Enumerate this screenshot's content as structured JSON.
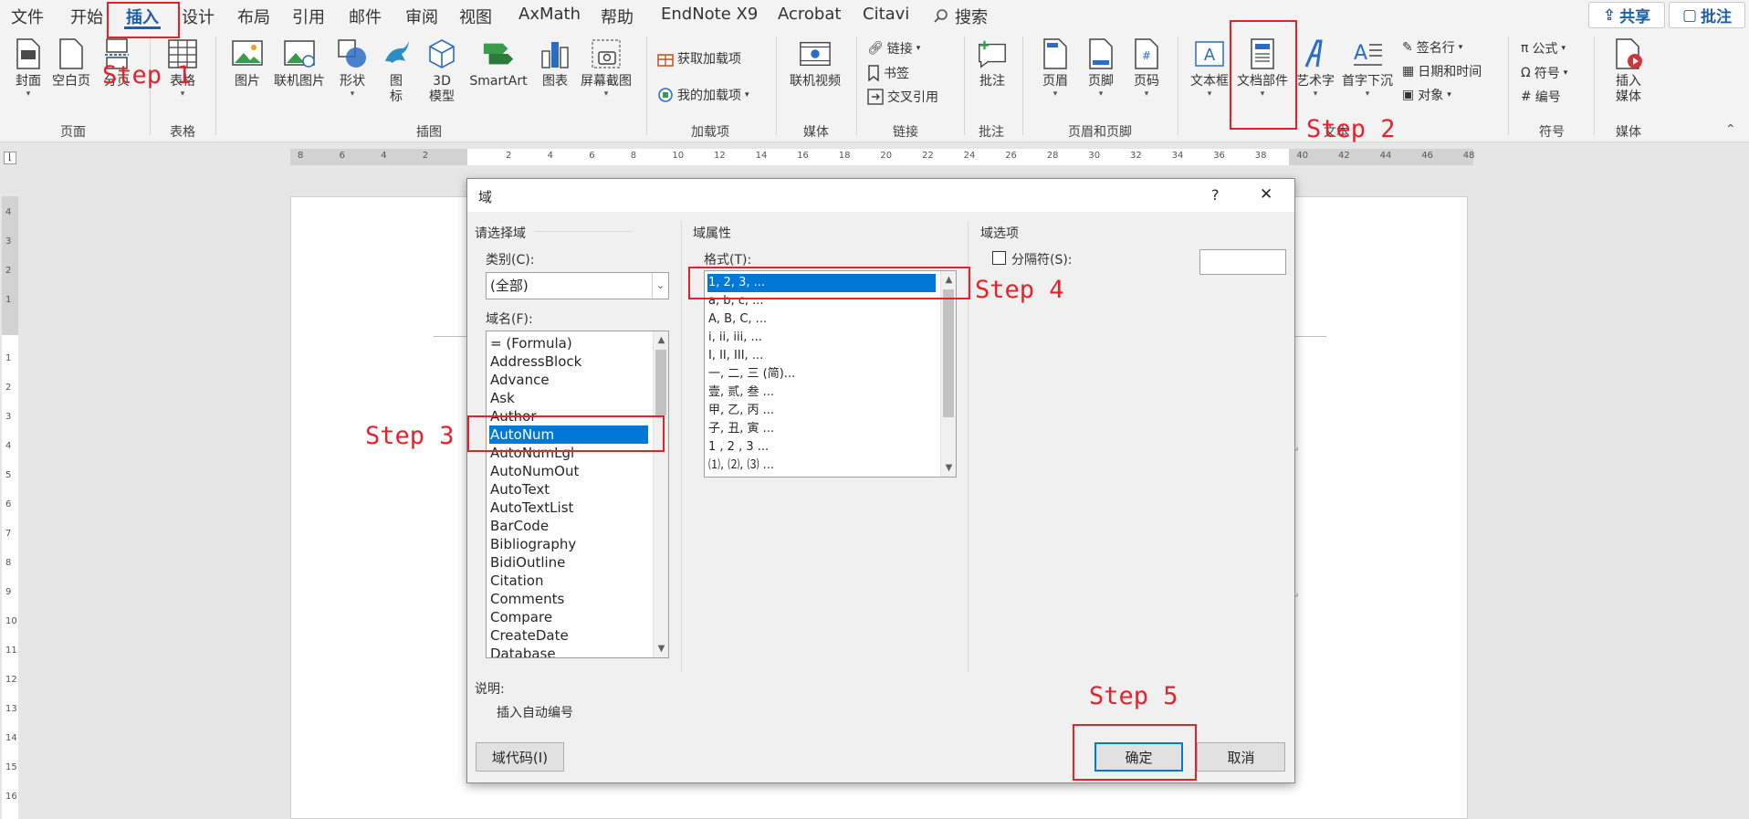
{
  "menu": {
    "tabs": [
      "文件",
      "开始",
      "插入",
      "设计",
      "布局",
      "引用",
      "邮件",
      "审阅",
      "视图",
      "AxMath",
      "帮助",
      "EndNote X9",
      "Acrobat",
      "Citavi"
    ],
    "active_tab": "插入",
    "search_label": "搜索",
    "share_label": "共享",
    "comments_label": "批注"
  },
  "ribbon": {
    "pages_group": {
      "label": "页面",
      "cover": "封面",
      "blank_page": "空白页",
      "page_break": "分页"
    },
    "table_group": {
      "label": "表格",
      "table": "表格"
    },
    "illustrations_group": {
      "label": "插图",
      "picture": "图片",
      "online_picture": "联机图片",
      "shapes": "形状",
      "icons_line1": "图",
      "icons_line2": "标",
      "model_line1": "3D",
      "model_line2": "模型",
      "smartart": "SmartArt",
      "chart": "图表",
      "screenshot": "屏幕截图"
    },
    "addins_group": {
      "label": "加载项",
      "get_addins": "获取加载项",
      "my_addins": "我的加载项"
    },
    "media_group": {
      "label": "媒体",
      "online_video": "联机视频"
    },
    "links_group": {
      "label": "链接",
      "link": "链接",
      "bookmark": "书签",
      "cross_ref": "交叉引用"
    },
    "comments_group": {
      "label": "批注",
      "comment": "批注"
    },
    "header_footer_group": {
      "label": "页眉和页脚",
      "header": "页眉",
      "footer": "页脚",
      "page_number": "页码"
    },
    "text_group": {
      "label": "文本",
      "textbox": "文本框",
      "quick_parts": "文档部件",
      "wordart": "艺术字",
      "dropcap": "首字下沉",
      "signature": "签名行",
      "datetime": "日期和时间",
      "object": "对象"
    },
    "symbols_group": {
      "label": "符号",
      "equation": "公式",
      "symbol": "符号",
      "number": "编号"
    },
    "media2_group": {
      "label": "媒体",
      "insert_media_line1": "插入",
      "insert_media_line2": "媒体"
    }
  },
  "ruler": {
    "ticks": [
      "8",
      "6",
      "4",
      "2",
      "",
      "2",
      "4",
      "6",
      "8",
      "10",
      "12",
      "14",
      "16",
      "18",
      "20",
      "22",
      "24",
      "26",
      "28",
      "30",
      "32",
      "34",
      "36",
      "38",
      "40",
      "42",
      "44",
      "46",
      "48"
    ],
    "vticks": [
      "4",
      "3",
      "2",
      "1",
      "",
      "1",
      "2",
      "3",
      "4",
      "5",
      "6",
      "7",
      "8",
      "9",
      "10",
      "11",
      "12",
      "13",
      "14",
      "15",
      "16"
    ]
  },
  "dialog": {
    "title": "域",
    "help": "?",
    "close": "✕",
    "choose_field_title": "请选择域",
    "category_label": "类别(C):",
    "category_value": "(全部)",
    "field_names_label": "域名(F):",
    "field_names": [
      "= (Formula)",
      "AddressBlock",
      "Advance",
      "Ask",
      "Author",
      "AutoNum",
      "AutoNumLgl",
      "AutoNumOut",
      "AutoText",
      "AutoTextList",
      "BarCode",
      "Bibliography",
      "BidiOutline",
      "Citation",
      "Comments",
      "Compare",
      "CreateDate",
      "Database"
    ],
    "selected_field": "AutoNum",
    "field_properties_title": "域属性",
    "format_label": "格式(T):",
    "formats": [
      "1, 2, 3, ...",
      "a, b, c, ...",
      "A, B, C, ...",
      "i, ii, iii, ...",
      "I, II, III, ...",
      "一, 二, 三 (简)...",
      "壹, 贰, 叁 ...",
      "甲, 乙, 丙 ...",
      "子, 丑, 寅 ...",
      "1 , 2 , 3  ...",
      "⑴, ⑵, ⑶ ..."
    ],
    "selected_format": "1, 2, 3, ...",
    "field_options_title": "域选项",
    "separator_label": "分隔符(S):",
    "description_label": "说明:",
    "description": "插入自动编号",
    "field_codes_button": "域代码(I)",
    "ok_button": "确定",
    "cancel_button": "取消"
  },
  "annotations": {
    "step1": "Step 1",
    "step2": "Step 2",
    "step3": "Step 3",
    "step4": "Step 4",
    "step5": "Step 5",
    "color": "#e8202a"
  }
}
